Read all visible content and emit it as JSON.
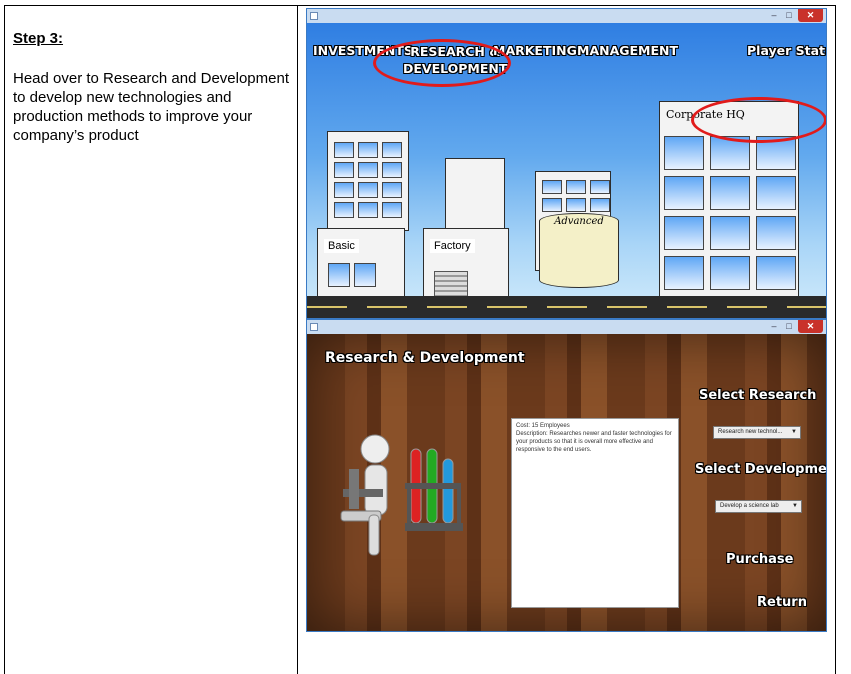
{
  "step": {
    "title": "Step 3:",
    "body": "Head over to Research and Development to develop new technologies and production methods to improve your company’s product"
  },
  "main_window": {
    "nav": {
      "investments": "INVESTMENTS",
      "research_line1": "RESEARCH &",
      "research_line2": "DEVELOPMENT",
      "marketing": "MARKETING",
      "management": "MANAGEMENT",
      "player_status": "Player Status"
    },
    "buildings": {
      "corporate_hq": "Corporate HQ",
      "advanced": "Advanced",
      "basic": "Basic",
      "factory": "Factory"
    }
  },
  "rd_window": {
    "title": "Research & Development",
    "select_research_label": "Select Research",
    "research_dropdown_value": "Research new technol...",
    "select_development_label": "Select Development",
    "development_dropdown_value": "Develop a science lab",
    "description_cost": "Cost: 15 Employees",
    "description_text": "Description: Researches newer and faster technologies for your products so that it is overall more effective and responsive to the end users.",
    "purchase_label": "Purchase",
    "return_label": "Return"
  },
  "window_controls": {
    "minimize": "–",
    "maximize": "□",
    "close": "✕"
  },
  "colors": {
    "highlight": "#e11b1b",
    "sky_top": "#2f7ee2",
    "wood": "#6b3a1c"
  }
}
